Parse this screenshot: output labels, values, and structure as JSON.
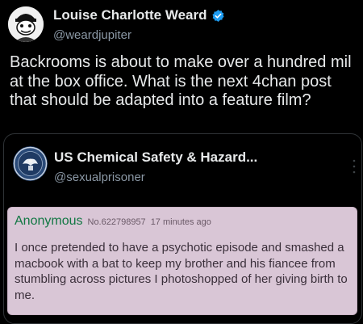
{
  "tweet": {
    "author_name": "Louise Charlotte Weard",
    "author_handle": "@weardjupiter",
    "text": "Backrooms is about to make over a hundred mil at the box office. What is the next 4chan post that should be adapted into a feature film?"
  },
  "quote": {
    "author_name": "US Chemical Safety & Hazard...",
    "author_handle": "@sexualprisoner",
    "post": {
      "poster_name": "Anonymous",
      "post_number": "No.622798957",
      "timestamp": "17 minutes ago",
      "body": "I once pretended to have a psychotic episode and smashed a macbook with a bat to keep my brother and his fiancee from stumbling across pictures I photoshopped of her giving birth to me."
    }
  },
  "colors": {
    "background": "#000000",
    "verified_badge": "#1d9bf0",
    "post_background": "#d9c6d6",
    "poster_name": "#117743"
  }
}
